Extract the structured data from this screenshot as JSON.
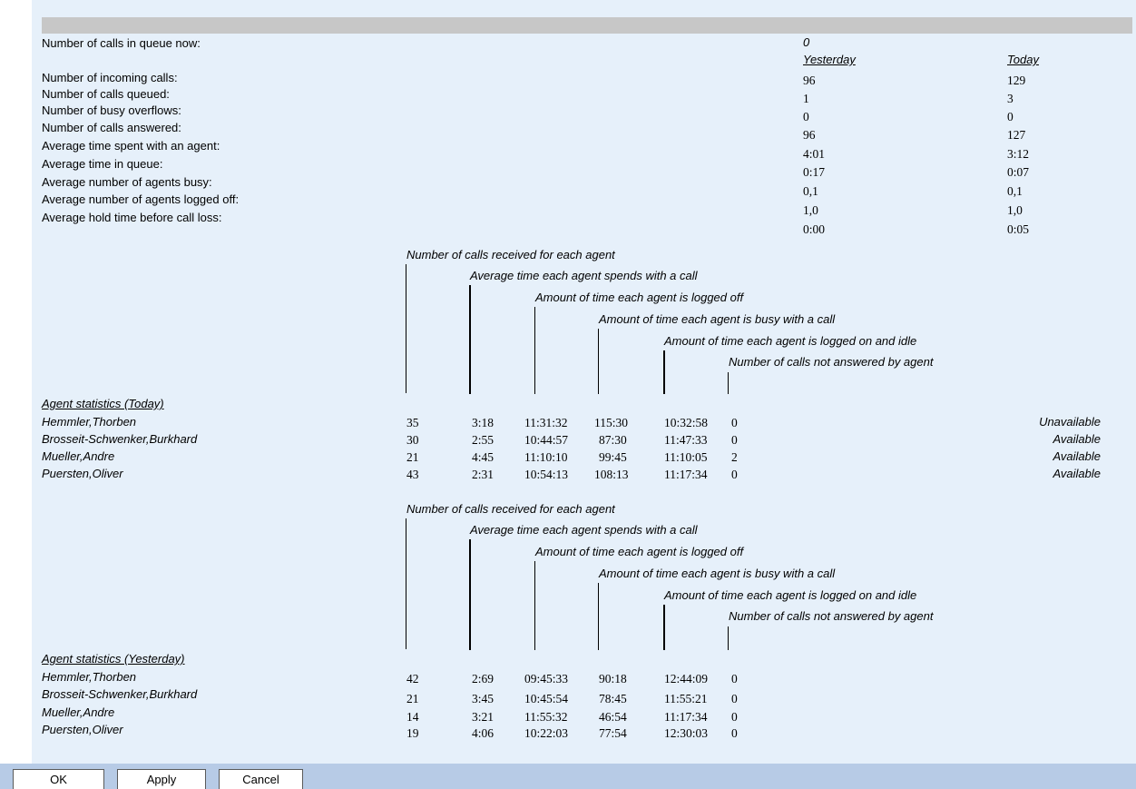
{
  "summary": {
    "queue_now_label": "Number of calls in queue now:",
    "queue_now_value": "0",
    "col_yesterday": "Yesterday",
    "col_today": "Today",
    "rows": [
      {
        "label": "Number of incoming calls:",
        "yesterday": "96",
        "today": "129"
      },
      {
        "label": "Number of calls queued:",
        "yesterday": "1",
        "today": "3"
      },
      {
        "label": "Number of busy overflows:",
        "yesterday": "0",
        "today": "0"
      },
      {
        "label": "Number of calls answered:",
        "yesterday": "96",
        "today": "127"
      },
      {
        "label": "Average time spent with an agent:",
        "yesterday": "4:01",
        "today": "3:12"
      },
      {
        "label": "Average time in queue:",
        "yesterday": "0:17",
        "today": "0:07"
      },
      {
        "label": "Average number of agents busy:",
        "yesterday": "0,1",
        "today": "0,1"
      },
      {
        "label": "Average number of agents logged off:",
        "yesterday": "1,0",
        "today": "1,0"
      },
      {
        "label": "Average hold time before call loss:",
        "yesterday": "0:00",
        "today": "0:05"
      }
    ]
  },
  "column_captions": [
    "Number of calls received for each agent",
    "Average time each agent spends with a call",
    "Amount of time each agent is logged off",
    "Amount of time each agent is busy with a call",
    "Amount of time each agent is logged on and idle",
    "Number of calls not answered by agent"
  ],
  "today": {
    "title": "Agent statistics (Today)",
    "agents": [
      {
        "name": "Hemmler,Thorben",
        "calls": "35",
        "avg": "3:18",
        "logged_off": "11:31:32",
        "busy": "115:30",
        "idle": "10:32:58",
        "not_answered": "0",
        "status": "Unavailable"
      },
      {
        "name": "Brosseit-Schwenker,Burkhard",
        "calls": "30",
        "avg": "2:55",
        "logged_off": "10:44:57",
        "busy": "87:30",
        "idle": "11:47:33",
        "not_answered": "0",
        "status": "Available"
      },
      {
        "name": "Mueller,Andre",
        "calls": "21",
        "avg": "4:45",
        "logged_off": "11:10:10",
        "busy": "99:45",
        "idle": "11:10:05",
        "not_answered": "2",
        "status": "Available"
      },
      {
        "name": "Puersten,Oliver",
        "calls": "43",
        "avg": "2:31",
        "logged_off": "10:54:13",
        "busy": "108:13",
        "idle": "11:17:34",
        "not_answered": "0",
        "status": "Available"
      }
    ]
  },
  "yesterday": {
    "title": "Agent statistics (Yesterday)",
    "agents": [
      {
        "name": "Hemmler,Thorben",
        "calls": "42",
        "avg": "2:69",
        "logged_off": "09:45:33",
        "busy": "90:18",
        "idle": "12:44:09",
        "not_answered": "0"
      },
      {
        "name": "Brosseit-Schwenker,Burkhard",
        "calls": "21",
        "avg": "3:45",
        "logged_off": "10:45:54",
        "busy": "78:45",
        "idle": "11:55:21",
        "not_answered": "0"
      },
      {
        "name": "Mueller,Andre",
        "calls": "14",
        "avg": "3:21",
        "logged_off": "11:55:32",
        "busy": "46:54",
        "idle": "11:17:34",
        "not_answered": "0"
      },
      {
        "name": "Puersten,Oliver",
        "calls": "19",
        "avg": "4:06",
        "logged_off": "10:22:03",
        "busy": "77:54",
        "idle": "12:30:03",
        "not_answered": "0"
      }
    ]
  },
  "buttons": {
    "ok": "OK",
    "apply": "Apply",
    "cancel": "Cancel"
  }
}
